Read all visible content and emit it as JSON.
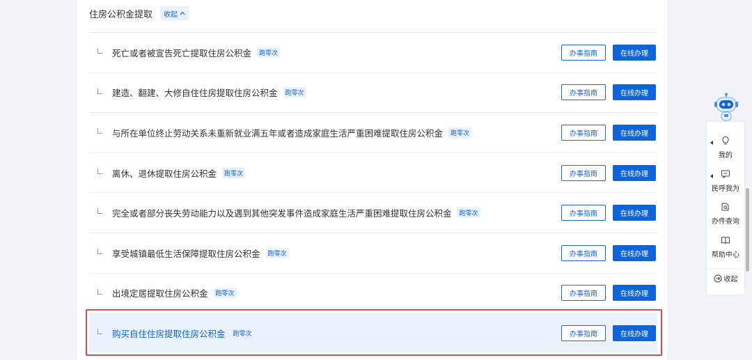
{
  "section": {
    "title": "住房公积金提取",
    "collapse_label": "收起"
  },
  "items": [
    {
      "label": "死亡或者被宣告死亡提取住房公积金",
      "badge": "跑零次",
      "guide": "办事指南",
      "online": "在线办理"
    },
    {
      "label": "建造、翻建、大修自住住房提取住房公积金",
      "badge": "跑零次",
      "guide": "办事指南",
      "online": "在线办理"
    },
    {
      "label": "与所在单位终止劳动关系未重新就业满五年或者造成家庭生活严重困难提取住房公积金",
      "badge": "跑零次",
      "guide": "办事指南",
      "online": "在线办理"
    },
    {
      "label": "离休、退休提取住房公积金",
      "badge": "跑零次",
      "guide": "办事指南",
      "online": "在线办理"
    },
    {
      "label": "完全或者部分丧失劳动能力以及遇到其他突发事件造成家庭生活严重困难提取住房公积金",
      "badge": "跑零次",
      "guide": "办事指南",
      "online": "在线办理"
    },
    {
      "label": "享受城镇最低生活保障提取住房公积金",
      "badge": "跑零次",
      "guide": "办事指南",
      "online": "在线办理"
    },
    {
      "label": "出境定居提取住房公积金",
      "badge": "跑零次",
      "guide": "办事指南",
      "online": "在线办理"
    },
    {
      "label": "购买自住住房提取住房公积金",
      "badge": "跑零次",
      "guide": "办事指南",
      "online": "在线办理"
    }
  ],
  "side_panel": {
    "mine": "我的",
    "feedback": "民呼我为",
    "query": "办件查询",
    "help": "帮助中心",
    "collapse": "收起"
  },
  "colors": {
    "accent": "#0f64d8",
    "highlight_border": "#e2474b",
    "highlight_bg": "#e9f2fd"
  },
  "icons": [
    "chevron-up-icon",
    "branch-icon",
    "robot-icon",
    "lightbulb-icon",
    "message-icon",
    "document-search-icon",
    "book-icon",
    "arrow-circle-right-icon"
  ]
}
